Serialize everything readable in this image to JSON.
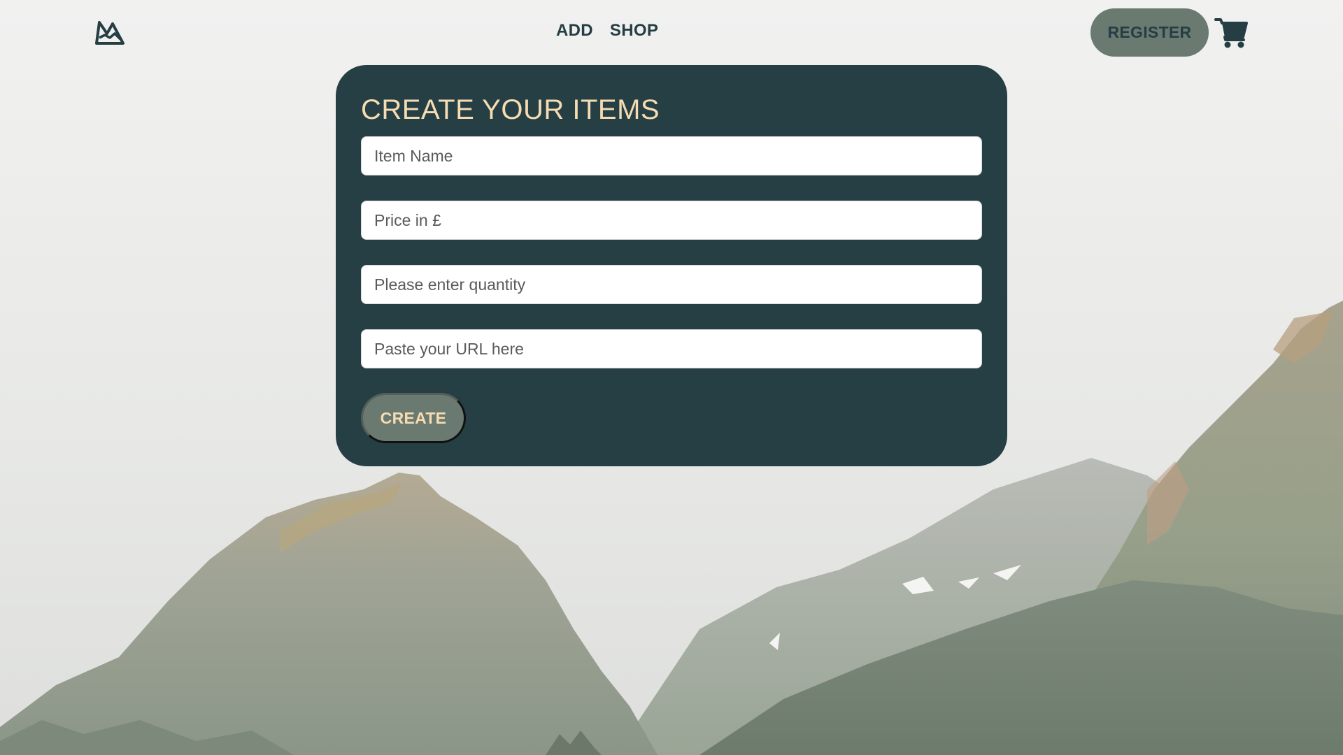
{
  "navbar": {
    "logo_icon": "mountain-logo-icon",
    "links": [
      {
        "label": "ADD"
      },
      {
        "label": "SHOP"
      }
    ],
    "register_label": "REGISTER",
    "cart_icon": "shopping-cart-icon"
  },
  "form": {
    "title": "CREATE YOUR ITEMS",
    "fields": {
      "item_name": {
        "placeholder": "Item Name",
        "value": ""
      },
      "price": {
        "placeholder": "Price in £",
        "value": ""
      },
      "quantity": {
        "placeholder": "Please enter quantity",
        "value": ""
      },
      "url": {
        "placeholder": "Paste your URL here",
        "value": ""
      }
    },
    "submit_label": "CREATE"
  },
  "colors": {
    "primary_dark": "#263f44",
    "accent_cream": "#f5dcb3",
    "button_sage": "#6a7a70",
    "nav_text": "#243e44"
  },
  "background": {
    "description_icon": "mountain-landscape-image"
  }
}
